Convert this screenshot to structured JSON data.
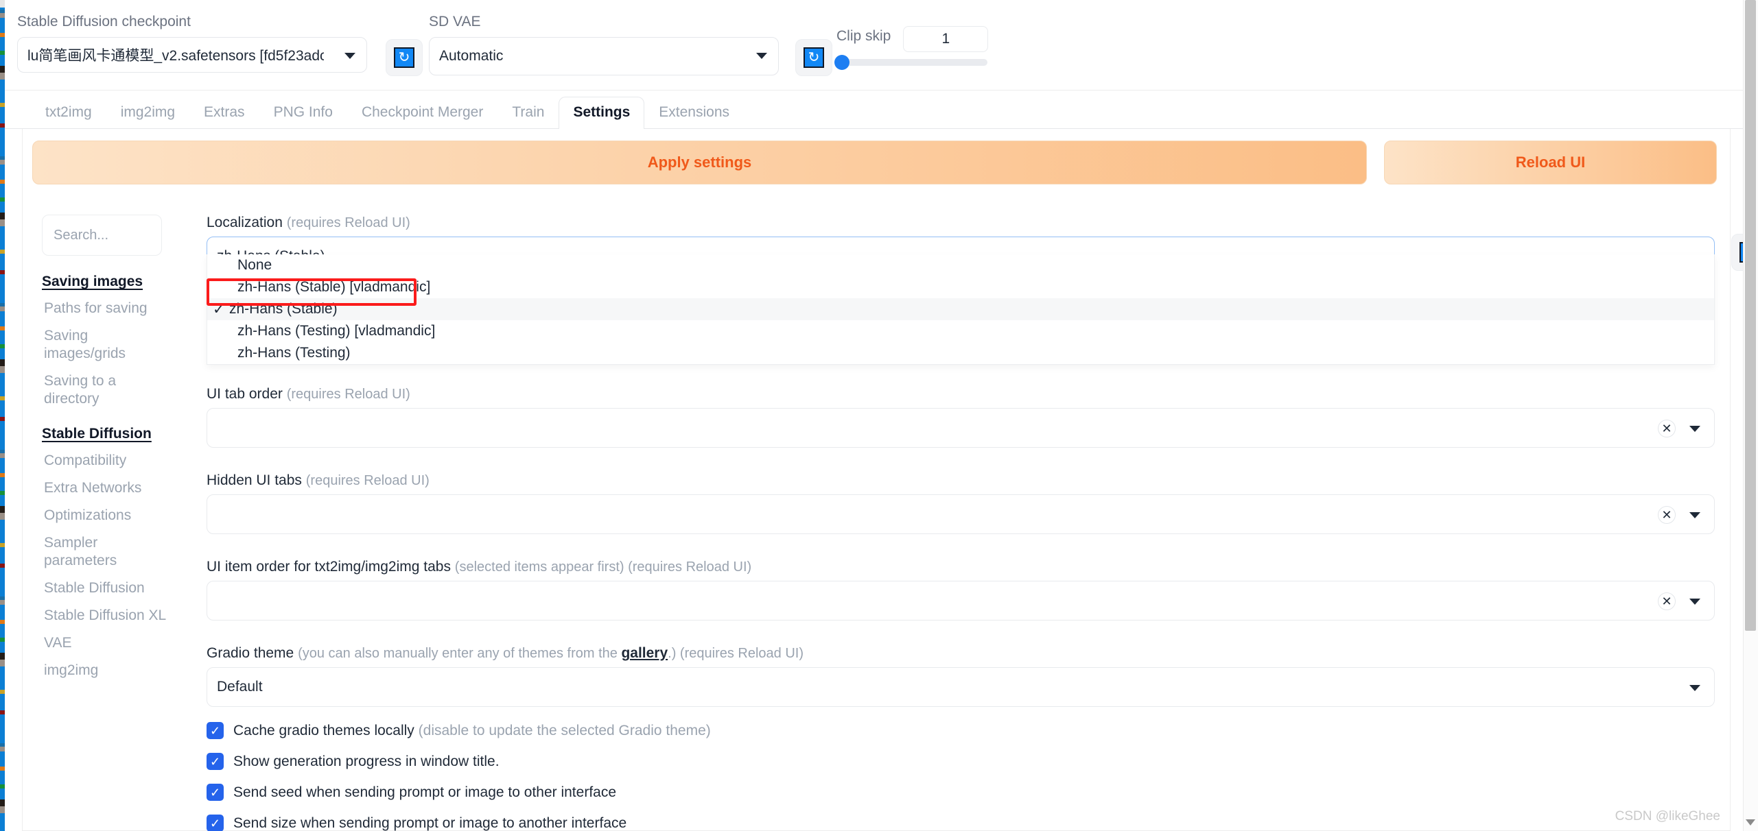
{
  "topbar": {
    "checkpoint_label": "Stable Diffusion checkpoint",
    "checkpoint_value": "lu简笔画风卡通模型_v2.safetensors [fd5f23adc",
    "checkpoint_refresh_icon": "refresh-icon",
    "vae_label": "SD VAE",
    "vae_value": "Automatic",
    "vae_refresh_icon": "refresh-icon",
    "clip_skip_label": "Clip skip",
    "clip_skip_value": "1"
  },
  "tabs": [
    {
      "label": "txt2img",
      "active": false
    },
    {
      "label": "img2img",
      "active": false
    },
    {
      "label": "Extras",
      "active": false
    },
    {
      "label": "PNG Info",
      "active": false
    },
    {
      "label": "Checkpoint Merger",
      "active": false
    },
    {
      "label": "Train",
      "active": false
    },
    {
      "label": "Settings",
      "active": true
    },
    {
      "label": "Extensions",
      "active": false
    }
  ],
  "actions": {
    "apply_label": "Apply settings",
    "reload_label": "Reload UI"
  },
  "sidebar": {
    "search_placeholder": "Search...",
    "groups": [
      {
        "title": "Saving images",
        "items": [
          "Paths for saving",
          "Saving images/grids",
          "Saving to a directory"
        ]
      },
      {
        "title": "Stable Diffusion",
        "items": [
          "Compatibility",
          "Extra Networks",
          "Optimizations",
          "Sampler parameters",
          "Stable Diffusion",
          "Stable Diffusion XL",
          "VAE",
          "img2img"
        ]
      }
    ]
  },
  "fields": {
    "localization": {
      "label": "Localization",
      "hint": "(requires Reload UI)",
      "value": "zh-Hans (Stable)",
      "refresh_icon": "refresh-icon",
      "options": [
        {
          "label": "None",
          "selected": false
        },
        {
          "label": "zh-Hans (Stable) [vladmandic]",
          "selected": false
        },
        {
          "label": "zh-Hans (Stable)",
          "selected": true
        },
        {
          "label": "zh-Hans (Testing) [vladmandic]",
          "selected": false
        },
        {
          "label": "zh-Hans (Testing)",
          "selected": false
        }
      ],
      "check_glyph": "✓",
      "highlight_color": "#fb1b1b"
    },
    "ui_tab_order": {
      "label": "UI tab order",
      "hint": "(requires Reload UI)",
      "value": "",
      "clear_glyph": "✕"
    },
    "hidden_ui_tabs": {
      "label": "Hidden UI tabs",
      "hint": "(requires Reload UI)",
      "value": "",
      "clear_glyph": "✕"
    },
    "ui_item_order": {
      "label": "UI item order for txt2img/img2img tabs",
      "hint": "(selected items appear first) (requires Reload UI)",
      "value": "",
      "clear_glyph": "✕"
    },
    "gradio_theme": {
      "label": "Gradio theme",
      "hint_pre": "(you can also manually enter any of themes from the ",
      "link": "gallery",
      "hint_post": ".) (requires Reload UI)",
      "value": "Default"
    }
  },
  "checkboxes": [
    {
      "checked": true,
      "label": "Cache gradio themes locally",
      "hint": "(disable to update the selected Gradio theme)"
    },
    {
      "checked": true,
      "label": "Show generation progress in window title.",
      "hint": ""
    },
    {
      "checked": true,
      "label": "Send seed when sending prompt or image to other interface",
      "hint": ""
    },
    {
      "checked": true,
      "label": "Send size when sending prompt or image to another interface",
      "hint": ""
    }
  ],
  "watermark": "CSDN @likeGhee",
  "colors": {
    "accent_blue": "#2563eb",
    "button_orange_text": "#f0591a",
    "highlight_red": "#fb1b1b"
  }
}
